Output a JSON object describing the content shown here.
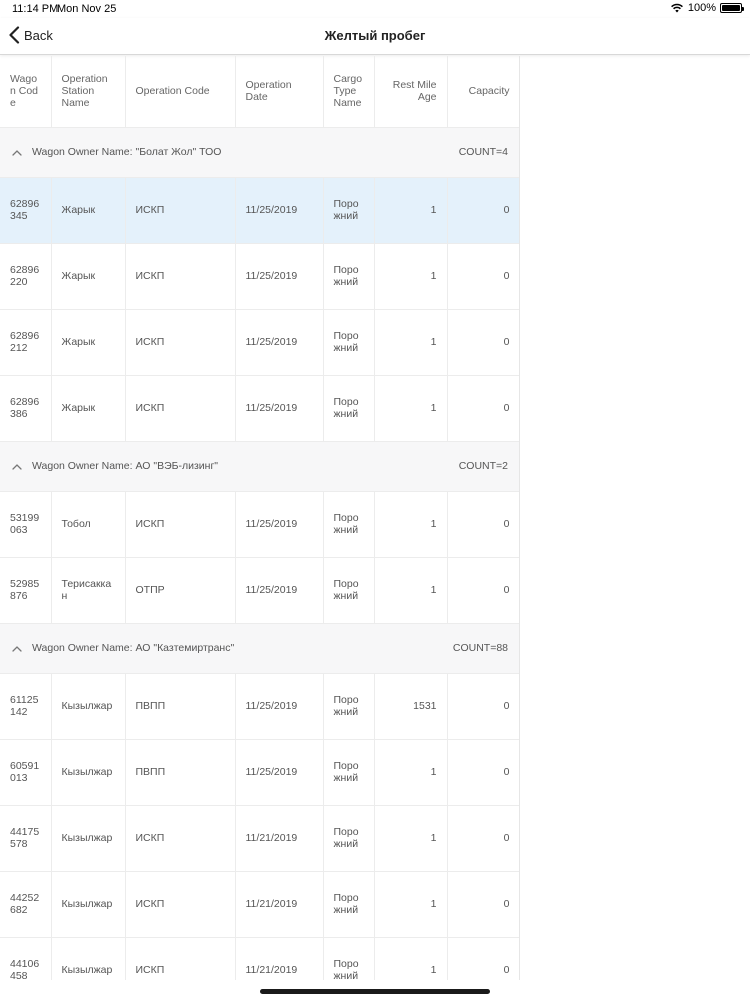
{
  "status": {
    "time": "11:14 PM",
    "date": "Mon Nov 25",
    "battery": "100%",
    "icons": [
      "wifi-icon",
      "battery-icon"
    ]
  },
  "nav": {
    "back_label": "Back",
    "title": "Желтый пробег"
  },
  "table": {
    "headers": [
      "Wagon Code",
      "Operation Station Name",
      "Operation Code",
      "Operation Date",
      "Cargo Type Name",
      "Rest Mile Age",
      "Capacity"
    ],
    "groups": [
      {
        "label": "Wagon Owner Name: \"Болат Жол\" ТОО",
        "count": "COUNT=4",
        "rows": [
          [
            "62896345",
            "Жарык",
            "ИСКП",
            "11/25/2019",
            "Порожний",
            "1",
            "0"
          ],
          [
            "62896220",
            "Жарык",
            "ИСКП",
            "11/25/2019",
            "Порожний",
            "1",
            "0"
          ],
          [
            "62896212",
            "Жарык",
            "ИСКП",
            "11/25/2019",
            "Порожний",
            "1",
            "0"
          ],
          [
            "62896386",
            "Жарык",
            "ИСКП",
            "11/25/2019",
            "Порожний",
            "1",
            "0"
          ]
        ]
      },
      {
        "label": "Wagon Owner Name: АО \"ВЭБ-лизинг\"",
        "count": "COUNT=2",
        "rows": [
          [
            "53199063",
            "Тобол",
            "ИСКП",
            "11/25/2019",
            "Порожний",
            "1",
            "0"
          ],
          [
            "52985876",
            "Терисаккан",
            "ОТПР",
            "11/25/2019",
            "Порожний",
            "1",
            "0"
          ]
        ]
      },
      {
        "label": "Wagon Owner Name: АО \"Казтемиртранс\"",
        "count": "COUNT=88",
        "rows": [
          [
            "61125142",
            "Кызылжар",
            "ПВПП",
            "11/25/2019",
            "Порожний",
            "1531",
            "0"
          ],
          [
            "60591013",
            "Кызылжар",
            "ПВПП",
            "11/25/2019",
            "Порожний",
            "1",
            "0"
          ],
          [
            "44175578",
            "Кызылжар",
            "ИСКП",
            "11/21/2019",
            "Порожний",
            "1",
            "0"
          ],
          [
            "44252682",
            "Кызылжар",
            "ИСКП",
            "11/21/2019",
            "Порожний",
            "1",
            "0"
          ],
          [
            "44106458",
            "Кызылжар",
            "ИСКП",
            "11/21/2019",
            "Порожний",
            "1",
            "0"
          ]
        ]
      }
    ],
    "selected_row": "62896345",
    "selection_color": "#e4f1fb"
  }
}
